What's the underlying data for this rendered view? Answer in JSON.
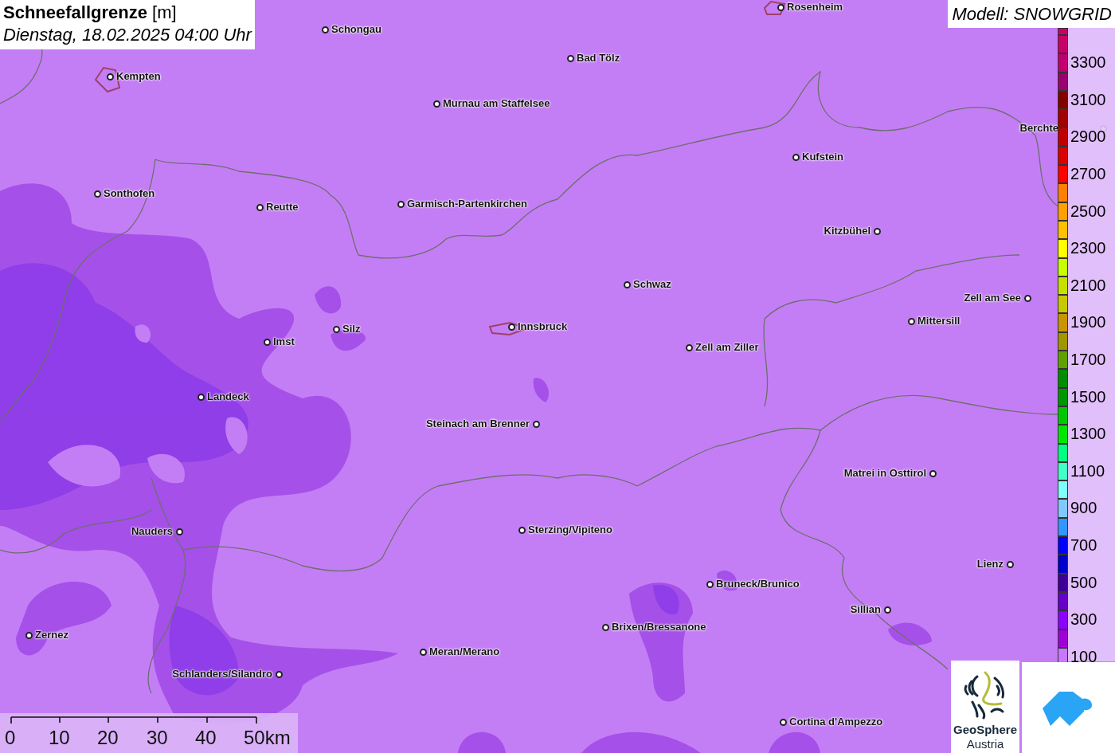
{
  "title": {
    "heading": "**Schneefallgrenze** [m]",
    "subtitle": "Dienstag, 18.02.2025 04:00 Uhr"
  },
  "model": "Modell: SNOWGRID",
  "cities": [
    {
      "name": "Schongau"
    },
    {
      "name": "Rosenheim"
    },
    {
      "name": "Bad Tölz"
    },
    {
      "name": "Kempten"
    },
    {
      "name": "Murnau am Staffelsee"
    },
    {
      "name": "Berchte"
    },
    {
      "name": "Kufstein"
    },
    {
      "name": "Sonthofen"
    },
    {
      "name": "Reutte"
    },
    {
      "name": "Garmisch-Partenkirchen"
    },
    {
      "name": "Kitzbühel"
    },
    {
      "name": "Schwaz"
    },
    {
      "name": "Zell am See"
    },
    {
      "name": "Silz"
    },
    {
      "name": "Innsbruck"
    },
    {
      "name": "Mittersill"
    },
    {
      "name": "Imst"
    },
    {
      "name": "Zell am Ziller"
    },
    {
      "name": "Landeck"
    },
    {
      "name": "Steinach am Brenner"
    },
    {
      "name": "Matrei in Osttirol"
    },
    {
      "name": "Nauders"
    },
    {
      "name": "Sterzing/Vipiteno"
    },
    {
      "name": "Lienz"
    },
    {
      "name": "Bruneck/Brunico"
    },
    {
      "name": "Sillian"
    },
    {
      "name": "Brixen/Bressanone"
    },
    {
      "name": "Zernez"
    },
    {
      "name": "Meran/Merano"
    },
    {
      "name": "Schlanders/Silandro"
    },
    {
      "name": "Cortina d'Ampezzo"
    }
  ],
  "legend": {
    "segments": [
      {
        "color": "#c8006a"
      },
      {
        "color": "#c8006a"
      },
      {
        "color": "#c00070",
        "label": "3300"
      },
      {
        "color": "#9a0070"
      },
      {
        "color": "#800000",
        "label": "3100"
      },
      {
        "color": "#a00000"
      },
      {
        "color": "#c00000",
        "label": "2900"
      },
      {
        "color": "#d80000"
      },
      {
        "color": "#ff0000",
        "label": "2700"
      },
      {
        "color": "#ff8000"
      },
      {
        "color": "#ffa000",
        "label": "2500"
      },
      {
        "color": "#ffc000"
      },
      {
        "color": "#ffff00",
        "label": "2300"
      },
      {
        "color": "#c8ff00"
      },
      {
        "color": "#c8e000",
        "label": "2100"
      },
      {
        "color": "#c8c800"
      },
      {
        "color": "#c89600",
        "label": "1900"
      },
      {
        "color": "#a09600"
      },
      {
        "color": "#60a000",
        "label": "1700"
      },
      {
        "color": "#008c00"
      },
      {
        "color": "#009600",
        "label": "1500"
      },
      {
        "color": "#00c800"
      },
      {
        "color": "#00e600",
        "label": "1300"
      },
      {
        "color": "#00ff80"
      },
      {
        "color": "#40ffc8",
        "label": "1100"
      },
      {
        "color": "#80ffff"
      },
      {
        "color": "#80c8ff",
        "label": "900"
      },
      {
        "color": "#3296ff"
      },
      {
        "color": "#0000ff",
        "label": "700"
      },
      {
        "color": "#0000c8"
      },
      {
        "color": "#3c0096",
        "label": "500"
      },
      {
        "color": "#6400c8"
      },
      {
        "color": "#8c00ff",
        "label": "300"
      },
      {
        "color": "#a000d8"
      },
      {
        "color": "#c878ff",
        "label": "100"
      }
    ]
  },
  "scale": {
    "ticks": [
      "0",
      "10",
      "20",
      "30",
      "40",
      "50km"
    ]
  },
  "logo": {
    "line1": "GeoSphere",
    "line2": "Austria"
  }
}
